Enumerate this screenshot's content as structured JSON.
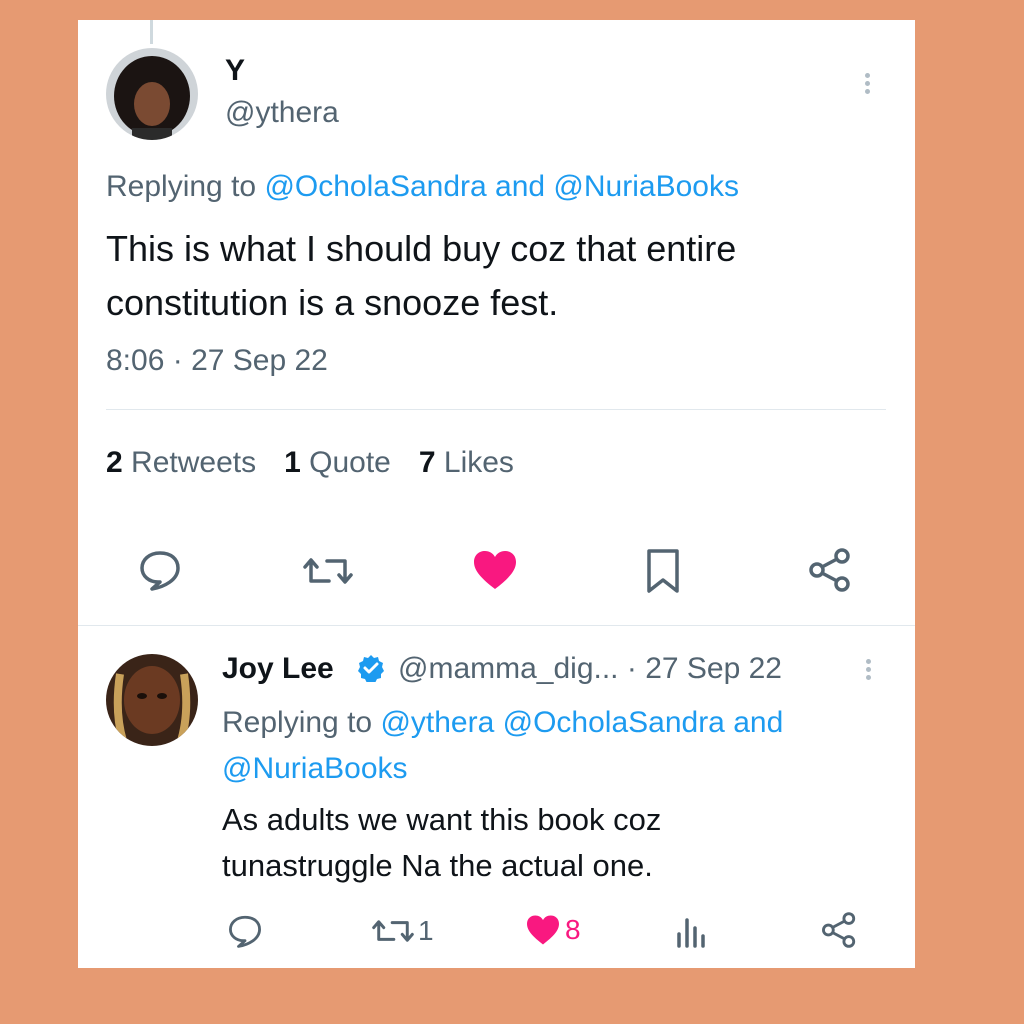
{
  "tweet": {
    "name": "Y",
    "handle": "@ythera",
    "replying_prefix": "Replying to ",
    "reply_mention_1": "@OcholaSandra",
    "reply_and": " and ",
    "reply_mention_2": "@NuriaBooks",
    "text_line_1": "This is what I should buy coz that entire",
    "text_line_2": "constitution is a snooze fest.",
    "time": "8:06",
    "sep": " · ",
    "date": "27 Sep 22",
    "stats": {
      "retweets_count": "2",
      "retweets_label": "Retweets",
      "quotes_count": "1",
      "quotes_label": "Quote",
      "likes_count": "7",
      "likes_label": "Likes"
    },
    "actions": [
      "reply-icon",
      "retweet-icon",
      "heart-icon",
      "bookmark-icon",
      "share-icon"
    ],
    "like_color": "#F91880"
  },
  "reply": {
    "name": "Joy Lee",
    "handle": "@mamma_dig...",
    "date_sep": " · ",
    "date": "27 Sep 22",
    "verified_color": "#1D9BF0",
    "replying_prefix": "Replying to ",
    "mention_1": "@ythera",
    "mention_2": "@OcholaSandra",
    "and": " and",
    "mention_3": "@NuriaBooks",
    "text_line_1": "As adults we want this book coz",
    "text_line_2": "tunastruggle Na the actual one.",
    "retweet_count": "1",
    "like_count": "8"
  },
  "colors": {
    "background": "#E69A72",
    "accent": "#1D9BF0",
    "like": "#F91880"
  }
}
